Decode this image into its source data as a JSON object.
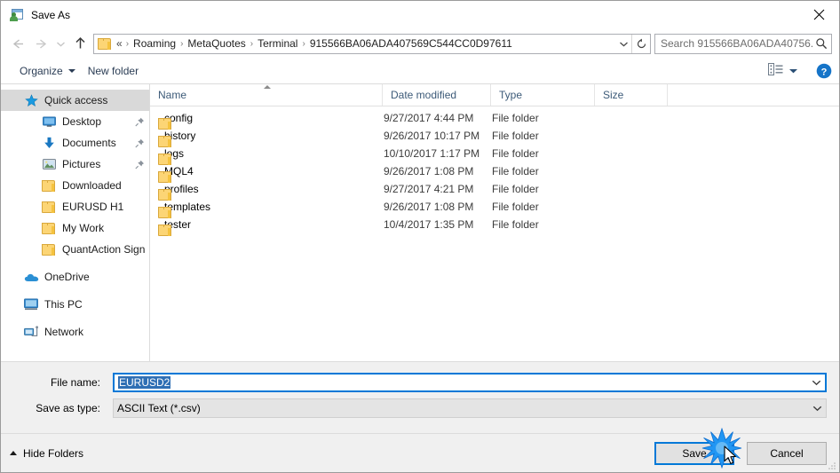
{
  "window": {
    "title": "Save As",
    "icon": "save-as-icon",
    "close_label": "✕"
  },
  "navigation": {
    "back_icon": "back-arrow-icon",
    "forward_icon": "forward-arrow-icon",
    "recent_icon": "recent-locations-chevron-icon",
    "up_icon": "up-arrow-icon",
    "address": {
      "folder_icon": "folder-icon",
      "lead": "«",
      "crumbs": [
        "Roaming",
        "MetaQuotes",
        "Terminal",
        "915566BA06ADA407569C544CC0D97611"
      ],
      "separator": "›",
      "dropdown_icon": "chevron-down-icon",
      "refresh_icon": "refresh-icon"
    },
    "search": {
      "placeholder": "Search 915566BA06ADA40756...",
      "icon": "search-icon"
    }
  },
  "commandbar": {
    "organize": "Organize",
    "new_folder": "New folder",
    "view_icon": "view-options-icon",
    "view_caret_icon": "chevron-down-icon",
    "help_icon": "help-icon",
    "help_label": "?"
  },
  "sidebar": {
    "items": [
      {
        "label": "Quick access",
        "icon": "star-icon",
        "level": 0,
        "selected": true,
        "pinned": false
      },
      {
        "label": "Desktop",
        "icon": "desktop-icon",
        "level": 1,
        "selected": false,
        "pinned": true
      },
      {
        "label": "Documents",
        "icon": "documents-download-icon",
        "level": 1,
        "selected": false,
        "pinned": true
      },
      {
        "label": "Pictures",
        "icon": "pictures-icon",
        "level": 1,
        "selected": false,
        "pinned": true
      },
      {
        "label": "Downloaded",
        "icon": "folder-icon",
        "level": 1,
        "selected": false,
        "pinned": false
      },
      {
        "label": "EURUSD H1",
        "icon": "folder-icon",
        "level": 1,
        "selected": false,
        "pinned": false
      },
      {
        "label": "My Work",
        "icon": "folder-icon",
        "level": 1,
        "selected": false,
        "pinned": false
      },
      {
        "label": "QuantAction Signal",
        "icon": "folder-icon",
        "level": 1,
        "selected": false,
        "pinned": false
      },
      {
        "label": "OneDrive",
        "icon": "onedrive-cloud-icon",
        "level": 0,
        "selected": false,
        "pinned": false,
        "gap_before": true
      },
      {
        "label": "This PC",
        "icon": "this-pc-icon",
        "level": 0,
        "selected": false,
        "pinned": false,
        "gap_before": true
      },
      {
        "label": "Network",
        "icon": "network-icon",
        "level": 0,
        "selected": false,
        "pinned": false,
        "gap_before": true
      }
    ]
  },
  "filelist": {
    "columns": [
      "Name",
      "Date modified",
      "Type",
      "Size"
    ],
    "sorted_by": "Name",
    "sort_direction": "ascending",
    "rows": [
      {
        "name": "config",
        "date": "9/27/2017 4:44 PM",
        "type": "File folder",
        "size": ""
      },
      {
        "name": "history",
        "date": "9/26/2017 10:17 PM",
        "type": "File folder",
        "size": ""
      },
      {
        "name": "logs",
        "date": "10/10/2017 1:17 PM",
        "type": "File folder",
        "size": ""
      },
      {
        "name": "MQL4",
        "date": "9/26/2017 1:08 PM",
        "type": "File folder",
        "size": ""
      },
      {
        "name": "profiles",
        "date": "9/27/2017 4:21 PM",
        "type": "File folder",
        "size": ""
      },
      {
        "name": "templates",
        "date": "9/26/2017 1:08 PM",
        "type": "File folder",
        "size": ""
      },
      {
        "name": "tester",
        "date": "10/4/2017 1:35 PM",
        "type": "File folder",
        "size": ""
      }
    ]
  },
  "form": {
    "filename_label": "File name:",
    "filename_value": "EURUSD2",
    "filetype_label": "Save as type:",
    "filetype_value": "ASCII Text (*.csv)",
    "dropdown_icon": "chevron-down-icon"
  },
  "footer": {
    "hide_folders": "Hide Folders",
    "hide_folders_icon": "chevron-up-icon",
    "save": "Save",
    "cancel": "Cancel",
    "resize_grip_icon": "resize-grip-icon"
  },
  "colors": {
    "accent": "#0078d7",
    "selection": "#2f6fb4",
    "chrome": "#f0f0f0",
    "folder": "#fcd575",
    "header_text": "#3c5a78"
  }
}
